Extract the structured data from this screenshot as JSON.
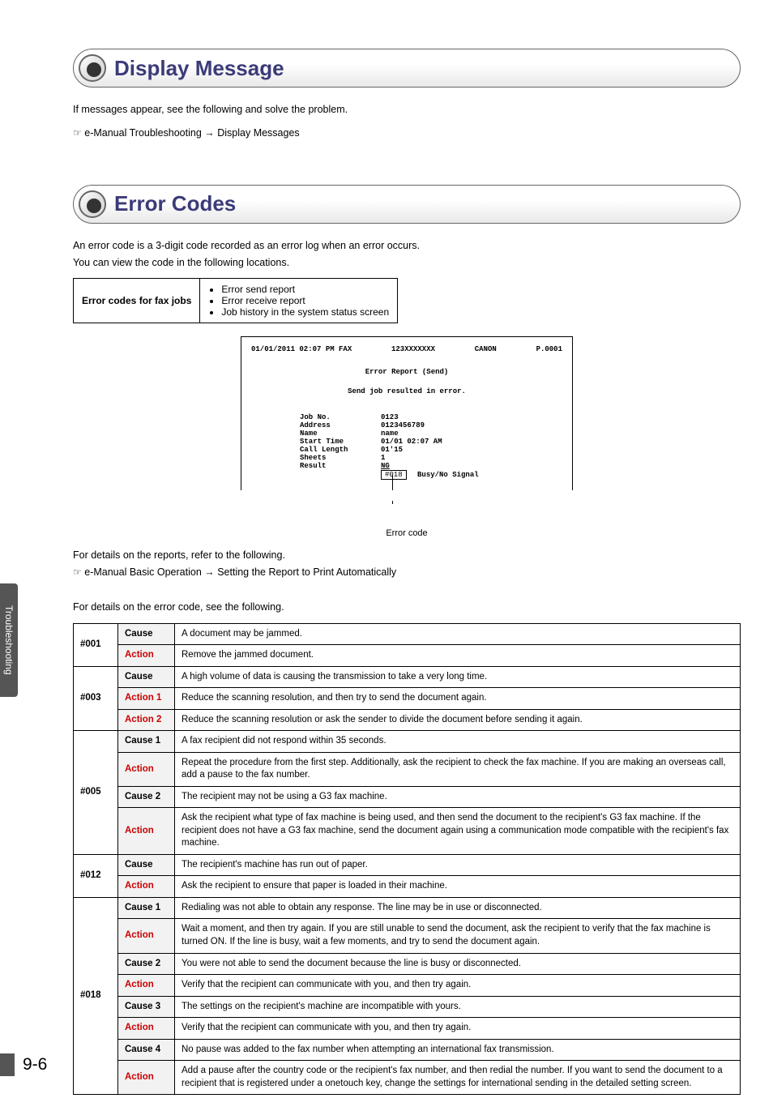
{
  "section1": {
    "title": "Display Message",
    "intro": "If messages appear, see the following and solve the problem.",
    "ref": "e-Manual  Troubleshooting  →  Display Messages"
  },
  "section2": {
    "title": "Error Codes",
    "intro1": "An error code is a 3-digit code recorded as an error log when an error occurs.",
    "intro2": "You can view the code in the following locations.",
    "small_table": {
      "header": "Error codes for fax jobs",
      "items": [
        "Error send report",
        "Error receive report",
        "Job history in the system status screen"
      ]
    },
    "report": {
      "top_left": "01/01/2011 02:07 PM  FAX",
      "top_mid1": "123XXXXXXX",
      "top_mid2": "CANON",
      "top_right": "P.0001",
      "title": "Error Report (Send)",
      "sub": "Send job resulted in error.",
      "rows": [
        {
          "k": "Job No.",
          "v": "0123"
        },
        {
          "k": "Address",
          "v": "0123456789"
        },
        {
          "k": "Name",
          "v": "name"
        },
        {
          "k": "Start Time",
          "v": "01/01 02:07 AM"
        },
        {
          "k": "Call Length",
          "v": "01'15"
        },
        {
          "k": "Sheets",
          "v": "1"
        }
      ],
      "result_label": "Result",
      "result_ng": "NG",
      "result_code": "#018",
      "result_reason": "Busy/No Signal",
      "caption": "Error code"
    },
    "details1": "For details on the reports, refer to the following.",
    "details1_ref": "e-Manual  Basic Operation  →  Setting the Report to Print Automatically",
    "details2": "For details on the error code, see the following.",
    "codes": [
      {
        "code": "#001",
        "rows": [
          {
            "label": "Cause",
            "cls": "",
            "text": "A document may be jammed."
          },
          {
            "label": "Action",
            "cls": "action",
            "text": "Remove the jammed document."
          }
        ]
      },
      {
        "code": "#003",
        "rows": [
          {
            "label": "Cause",
            "cls": "",
            "text": "A high volume of data is causing the transmission to take a very long time."
          },
          {
            "label": "Action 1",
            "cls": "action",
            "text": "Reduce the scanning resolution, and then try to send the document again."
          },
          {
            "label": "Action 2",
            "cls": "action",
            "text": "Reduce the scanning resolution or ask the sender to divide the document before sending it again."
          }
        ]
      },
      {
        "code": "#005",
        "rows": [
          {
            "label": "Cause 1",
            "cls": "",
            "text": "A fax recipient did not respond within 35 seconds."
          },
          {
            "label": "Action",
            "cls": "action",
            "text": "Repeat the procedure from the first step. Additionally, ask the recipient to check the fax machine. If you are making an overseas call, add a pause to the fax number."
          },
          {
            "label": "Cause 2",
            "cls": "",
            "text": "The recipient may not be using a G3 fax machine."
          },
          {
            "label": "Action",
            "cls": "action",
            "text": "Ask the recipient what type of fax machine is being used, and then send the document to the recipient's G3 fax machine. If the recipient does not have a G3 fax machine, send the document again using a communication mode compatible with the recipient's fax machine."
          }
        ]
      },
      {
        "code": "#012",
        "rows": [
          {
            "label": "Cause",
            "cls": "",
            "text": "The recipient's machine has run out of paper."
          },
          {
            "label": "Action",
            "cls": "action",
            "text": "Ask the recipient to ensure that paper is loaded in their machine."
          }
        ]
      },
      {
        "code": "#018",
        "rows": [
          {
            "label": "Cause 1",
            "cls": "",
            "text": "Redialing was not able to obtain any response. The line may be in use or disconnected."
          },
          {
            "label": "Action",
            "cls": "action",
            "text": "Wait a moment, and then try again. If you are still unable to send the document, ask the recipient to verify that the fax machine is turned ON. If the line is busy, wait a few moments, and try to send the document again."
          },
          {
            "label": "Cause 2",
            "cls": "",
            "text": "You were not able to send the document because the line is busy or disconnected."
          },
          {
            "label": "Action",
            "cls": "action",
            "text": "Verify that the recipient can communicate with you, and then try again."
          },
          {
            "label": "Cause 3",
            "cls": "",
            "text": "The settings on the recipient's machine are incompatible with yours."
          },
          {
            "label": "Action",
            "cls": "action",
            "text": "Verify that the recipient can communicate with you, and then try again."
          },
          {
            "label": "Cause 4",
            "cls": "",
            "text": "No pause was added to the fax number when attempting an international fax transmission."
          },
          {
            "label": "Action",
            "cls": "action",
            "text": "Add a pause after the country code or the recipient's fax number, and then redial the number. If you want to send the document to a recipient that is registered under a onetouch key, change the settings for international sending in the detailed setting screen."
          }
        ]
      }
    ]
  },
  "sidebar": "Troubleshooting",
  "page_number": "9-6"
}
